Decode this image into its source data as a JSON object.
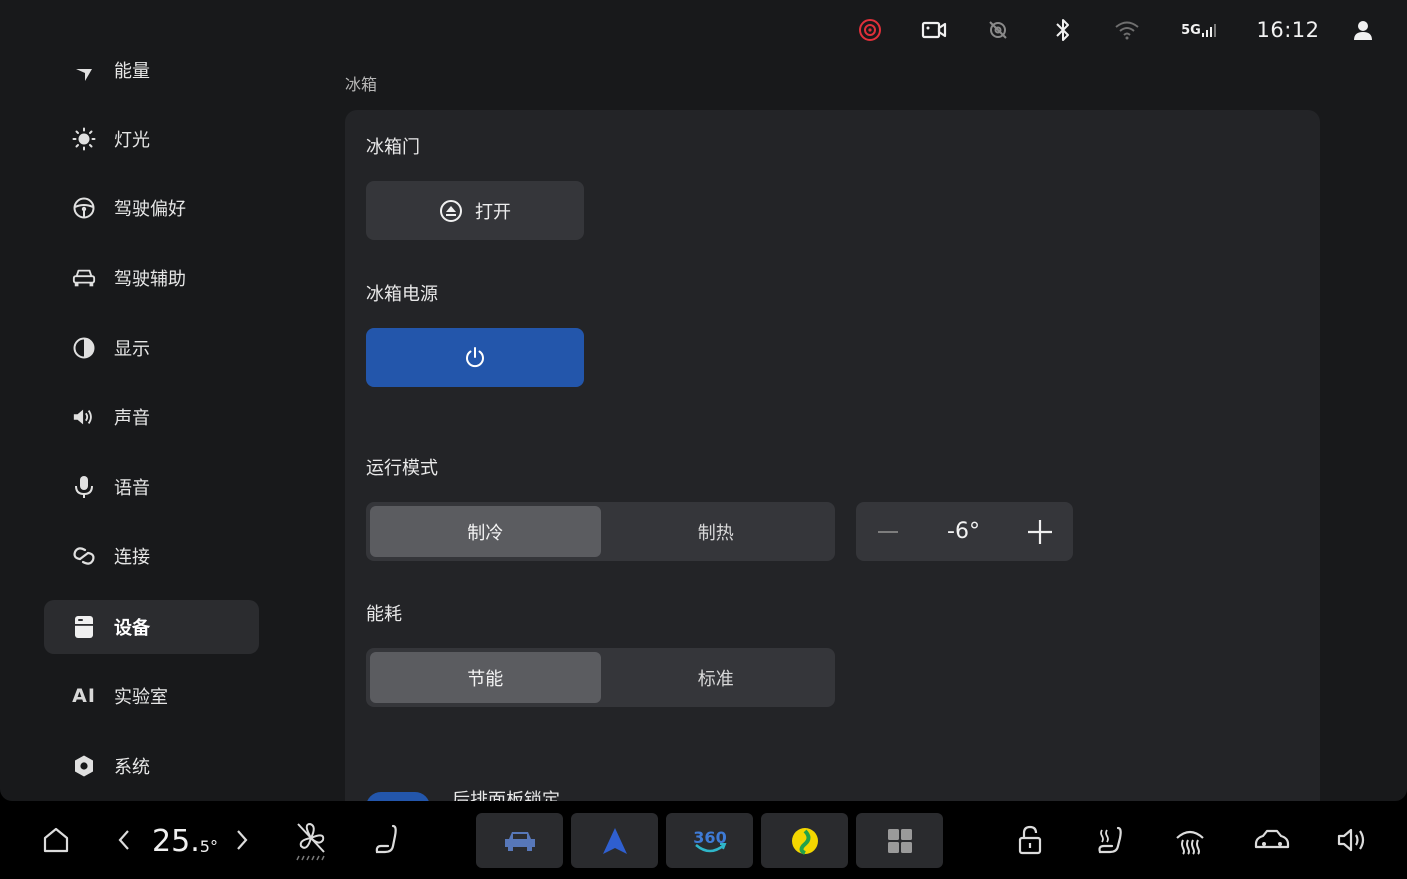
{
  "status_bar": {
    "network": "5G",
    "time": "16:12",
    "icons": [
      "record-icon",
      "camera-icon",
      "location-off-icon",
      "bluetooth-icon",
      "wifi-icon",
      "signal-icon",
      "user-icon"
    ]
  },
  "sidebar": {
    "items": [
      {
        "label": "能量",
        "icon": "energy-icon"
      },
      {
        "label": "灯光",
        "icon": "light-icon"
      },
      {
        "label": "驾驶偏好",
        "icon": "steering-wheel-icon"
      },
      {
        "label": "驾驶辅助",
        "icon": "car-icon"
      },
      {
        "label": "显示",
        "icon": "display-icon"
      },
      {
        "label": "声音",
        "icon": "speaker-icon"
      },
      {
        "label": "语音",
        "icon": "microphone-icon"
      },
      {
        "label": "连接",
        "icon": "link-icon"
      },
      {
        "label": "设备",
        "icon": "device-icon",
        "active": true
      },
      {
        "label": "实验室",
        "icon": "ai-icon",
        "icon_text": "AI"
      },
      {
        "label": "系统",
        "icon": "system-icon"
      }
    ]
  },
  "content": {
    "section_title": "冰箱",
    "fridge_door": {
      "label": "冰箱门",
      "button": "打开"
    },
    "fridge_power": {
      "label": "冰箱电源",
      "on": true
    },
    "run_mode": {
      "label": "运行模式",
      "options": [
        "制冷",
        "制热"
      ],
      "selected": "制冷"
    },
    "temperature": {
      "value": "-6°"
    },
    "energy": {
      "label": "能耗",
      "options": [
        "节能",
        "标准"
      ],
      "selected": "节能"
    },
    "rear_panel_lock": {
      "label": "后排面板锁定"
    }
  },
  "dock": {
    "temp_main": "25.",
    "temp_decimal": "5°"
  },
  "colors": {
    "accent_blue": "#2356ab",
    "background": "#18191b",
    "card": "#232427",
    "record_red": "#e0303a"
  }
}
